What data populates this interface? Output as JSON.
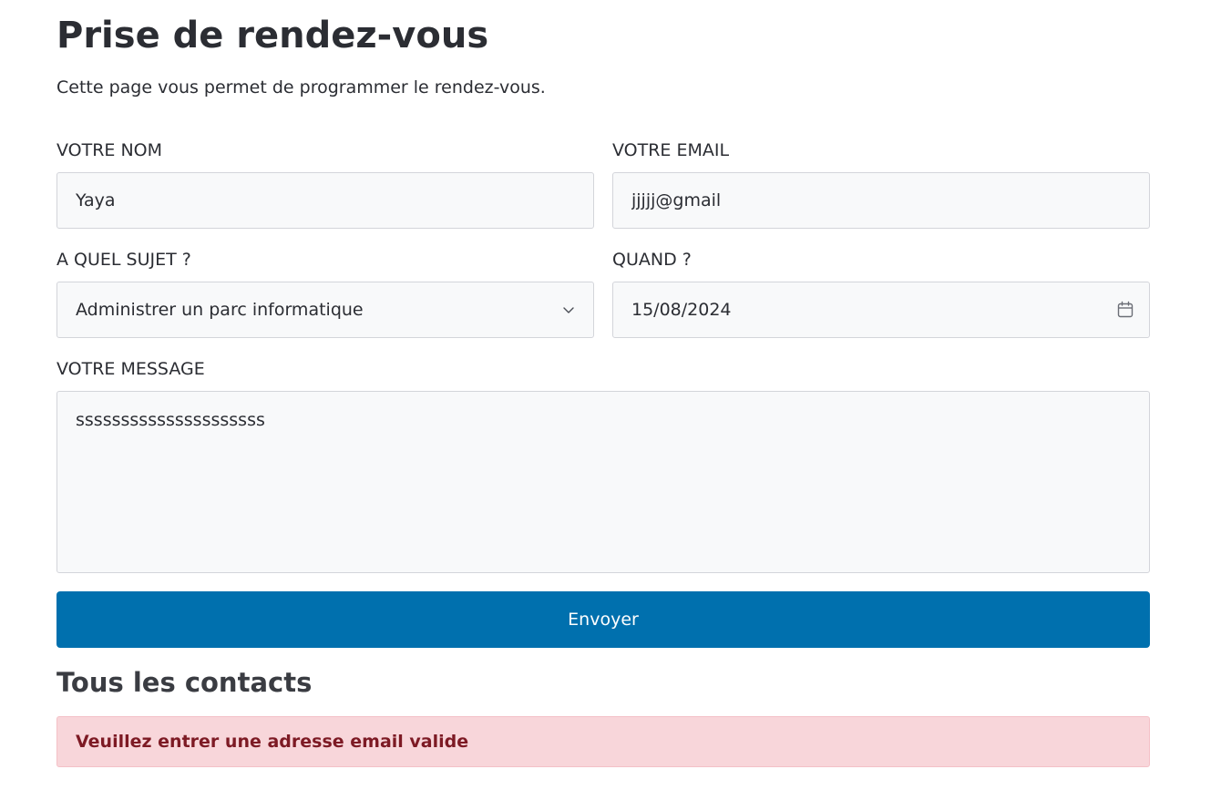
{
  "page": {
    "title": "Prise de rendez-vous",
    "subtitle": "Cette page vous permet de programmer le rendez-vous."
  },
  "form": {
    "name_label": "VOTRE NOM",
    "name_value": "Yaya",
    "email_label": "VOTRE EMAIL",
    "email_value": "jjjjj@gmail",
    "subject_label": "A QUEL SUJET ?",
    "subject_selected": "Administrer un parc informatique",
    "date_label": "QUAND ?",
    "date_value": "15/08/2024",
    "message_label": "VOTRE MESSAGE",
    "message_value": "sssssssssssssssssssss",
    "submit_label": "Envoyer"
  },
  "contacts": {
    "heading": "Tous les contacts",
    "error_message": "Veuillez entrer une adresse email valide"
  },
  "colors": {
    "primary": "#0070ae",
    "alert_background": "#f8d6da",
    "alert_text": "#7d1a24",
    "field_background": "#f8f9fa",
    "field_border": "#d3d5da"
  },
  "icons": {
    "select": "chevron-down-icon",
    "date": "calendar-icon"
  }
}
